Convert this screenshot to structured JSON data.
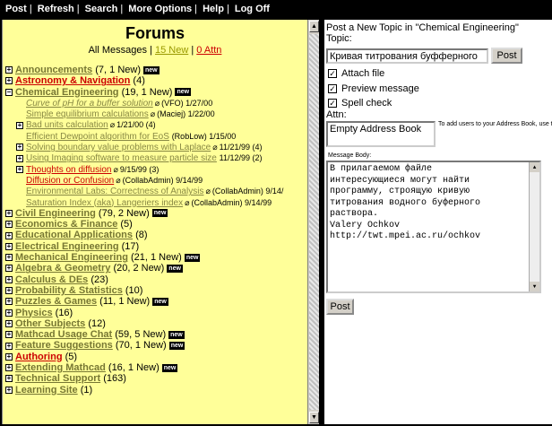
{
  "menu": [
    "Post",
    "Refresh",
    "Search",
    "More Options",
    "Help",
    "Log Off"
  ],
  "forums": {
    "title": "Forums",
    "all_messages": "All Messages",
    "new_link": "15 New",
    "attn_link": "0 Attn",
    "sep": "|",
    "new_badge": "new"
  },
  "categories_before": [
    {
      "name": "Announcements",
      "count": "(7, 1 New)",
      "is_new": true,
      "red": false,
      "expanded": false
    },
    {
      "name": "Astronomy & Navigation",
      "count": "(4)",
      "is_new": false,
      "red": true,
      "expanded": false
    },
    {
      "name": "Chemical Engineering",
      "count": "(19, 1 New)",
      "is_new": true,
      "red": false,
      "expanded": true
    }
  ],
  "topics": [
    {
      "title": "Curve of pH for a buffer solution",
      "meta": "(VFO) 1/27/00",
      "expandable": false,
      "red": false,
      "italic": true
    },
    {
      "title": "Simple equilibrium calculations",
      "meta": "(Maciej) 1/22/00",
      "expandable": false,
      "red": false,
      "italic": false
    },
    {
      "title": "Bad units calculation",
      "meta": "1/21/00 (4)",
      "expandable": true,
      "red": false,
      "italic": false
    },
    {
      "title": "Efficient Dewpoint algorithm for EoS",
      "meta": "(RobLow) 1/15/00",
      "expandable": false,
      "red": false,
      "italic": false,
      "no_clip": true
    },
    {
      "title": "Solving boundary value problems with Laplace",
      "meta": "11/21/99 (4)",
      "expandable": true,
      "red": false,
      "italic": false
    },
    {
      "title": "Using Imaging software to measure particle size",
      "meta": "11/12/99 (2)",
      "expandable": true,
      "red": false,
      "italic": false,
      "no_clip": true
    },
    {
      "title": "Thoughts on diffusion",
      "meta": "9/15/99 (3)",
      "expandable": true,
      "red": true,
      "italic": false
    },
    {
      "title": "Diffusion or Confusion",
      "meta": "(CollabAdmin) 9/14/99",
      "expandable": false,
      "red": true,
      "italic": false
    },
    {
      "title": "Environmental Labs: Correctness of Analysis",
      "meta": "(CollabAdmin) 9/14/",
      "expandable": false,
      "red": false,
      "italic": false
    },
    {
      "title": "Saturation Index (aka) Langeriers index",
      "meta": "(CollabAdmin) 9/14/99",
      "expandable": false,
      "red": false,
      "italic": false
    }
  ],
  "categories_after": [
    {
      "name": "Civil Engineering",
      "count": "(79, 2 New)",
      "is_new": true,
      "red": false
    },
    {
      "name": "Economics & Finance",
      "count": "(5)",
      "is_new": false,
      "red": false
    },
    {
      "name": "Educational Applications",
      "count": "(8)",
      "is_new": false,
      "red": false
    },
    {
      "name": "Electrical Engineering",
      "count": "(17)",
      "is_new": false,
      "red": false
    },
    {
      "name": "Mechanical Engineering",
      "count": "(21, 1 New)",
      "is_new": true,
      "red": false
    },
    {
      "name": "Algebra & Geometry",
      "count": "(20, 2 New)",
      "is_new": true,
      "red": false
    },
    {
      "name": "Calculus & DEs",
      "count": "(23)",
      "is_new": false,
      "red": false
    },
    {
      "name": "Probability & Statistics",
      "count": "(10)",
      "is_new": false,
      "red": false
    },
    {
      "name": "Puzzles & Games",
      "count": "(11, 1 New)",
      "is_new": true,
      "red": false
    },
    {
      "name": "Physics",
      "count": "(16)",
      "is_new": false,
      "red": false
    },
    {
      "name": "Other Subjects",
      "count": "(12)",
      "is_new": false,
      "red": false
    },
    {
      "name": "Mathcad Usage Chat",
      "count": "(59, 5 New)",
      "is_new": true,
      "red": false
    },
    {
      "name": "Feature Suggestions",
      "count": "(70, 1 New)",
      "is_new": true,
      "red": false
    },
    {
      "name": "Authoring",
      "count": "(5)",
      "is_new": false,
      "red": true
    },
    {
      "name": "Extending Mathcad",
      "count": "(16, 1 New)",
      "is_new": true,
      "red": false
    },
    {
      "name": "Technical Support",
      "count": "(163)",
      "is_new": false,
      "red": false
    },
    {
      "name": "Learning Site",
      "count": "(1)",
      "is_new": false,
      "red": false
    }
  ],
  "post": {
    "heading": "Post a New Topic in \"Chemical Engineering\"",
    "topic_label": "Topic:",
    "topic_value": "Кривая титрования буфферного",
    "post_button": "Post",
    "attach_file": "Attach file",
    "preview_message": "Preview message",
    "spell_check": "Spell check",
    "attn_label": "Attn:",
    "attn_value": "Empty Address Book",
    "attn_note": "To add users to your Address Book, use the menu.",
    "body_label": "Message Body:",
    "body_lines": [
      "В прилагаемом файле",
      "интересующиеся могут найти",
      "программу, строящую кривую",
      "титрования водного буферного",
      "раствора.",
      "Valery Ochkov",
      "http://twt.mpei.ac.ru/ochkov"
    ],
    "bottom_button": "Post"
  }
}
